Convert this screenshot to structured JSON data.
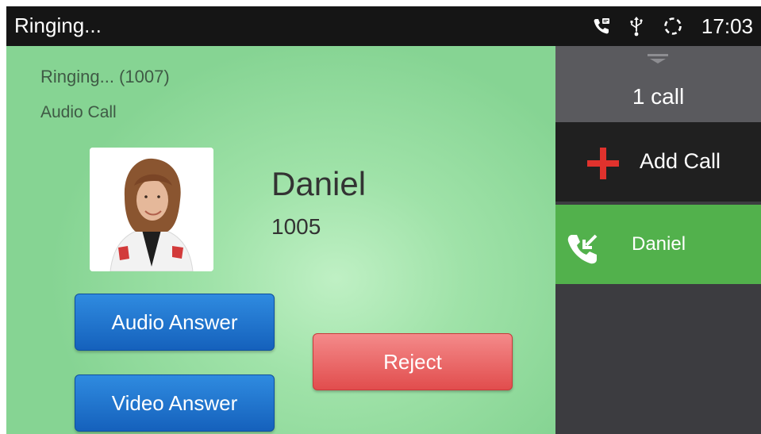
{
  "status_bar": {
    "title": "Ringing...",
    "time": "17:03",
    "icons": [
      "call-message-icon",
      "usb-icon",
      "sync-icon"
    ]
  },
  "call": {
    "ringing_text": "Ringing... (1007)",
    "call_type": "Audio Call",
    "contact_name": "Daniel",
    "contact_number": "1005"
  },
  "buttons": {
    "audio_answer": "Audio Answer",
    "video_answer": "Video Answer",
    "reject": "Reject"
  },
  "sidebar": {
    "call_count": "1 call",
    "add_call": "Add Call",
    "calls": [
      {
        "name": "Daniel"
      }
    ]
  },
  "colors": {
    "call_panel": "#9fe2a8",
    "active_call": "#52b14c",
    "answer_button": "#1f72cf",
    "reject_button": "#e8605f",
    "add_icon": "#e0322d"
  }
}
